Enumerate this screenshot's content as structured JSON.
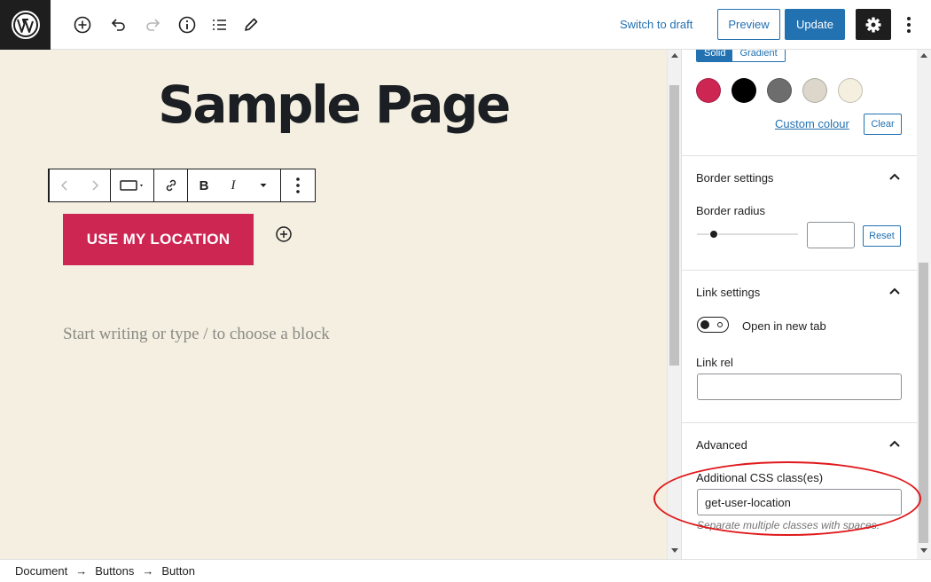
{
  "header": {
    "switch_to_draft": "Switch to draft",
    "preview": "Preview",
    "update": "Update",
    "icons": [
      "wordpress-logo",
      "add-block",
      "undo",
      "redo",
      "details",
      "list-view",
      "tools",
      "settings",
      "more-options"
    ]
  },
  "editor": {
    "title": "Sample Page",
    "button_text": "USE MY LOCATION",
    "placeholder": "Start writing or type / to choose a block",
    "toolbar": {
      "bold_label": "B",
      "italic_label": "I"
    }
  },
  "sidebar": {
    "color": {
      "solid_tab": "Solid",
      "gradient_tab": "Gradient",
      "swatches": [
        "#cd2653",
        "#000000",
        "#6d6d6d",
        "#dcd7ca",
        "#f5efe0"
      ],
      "custom_colour": "Custom colour",
      "clear": "Clear"
    },
    "border": {
      "title": "Border settings",
      "radius_label": "Border radius",
      "radius_value": "",
      "reset": "Reset"
    },
    "link": {
      "title": "Link settings",
      "open_new_tab": "Open in new tab",
      "open_new_tab_checked": false,
      "rel_label": "Link rel",
      "rel_value": ""
    },
    "advanced": {
      "title": "Advanced",
      "css_label": "Additional CSS class(es)",
      "css_value": "get-user-location",
      "css_help": "Separate multiple classes with spaces."
    }
  },
  "breadcrumb": {
    "items": [
      "Document",
      "Buttons",
      "Button"
    ],
    "separator": "→"
  },
  "colors": {
    "accent": "#2271b1",
    "button_bg": "#cd2653",
    "canvas_bg": "#f4efe1",
    "annotation": "#e0191c"
  }
}
